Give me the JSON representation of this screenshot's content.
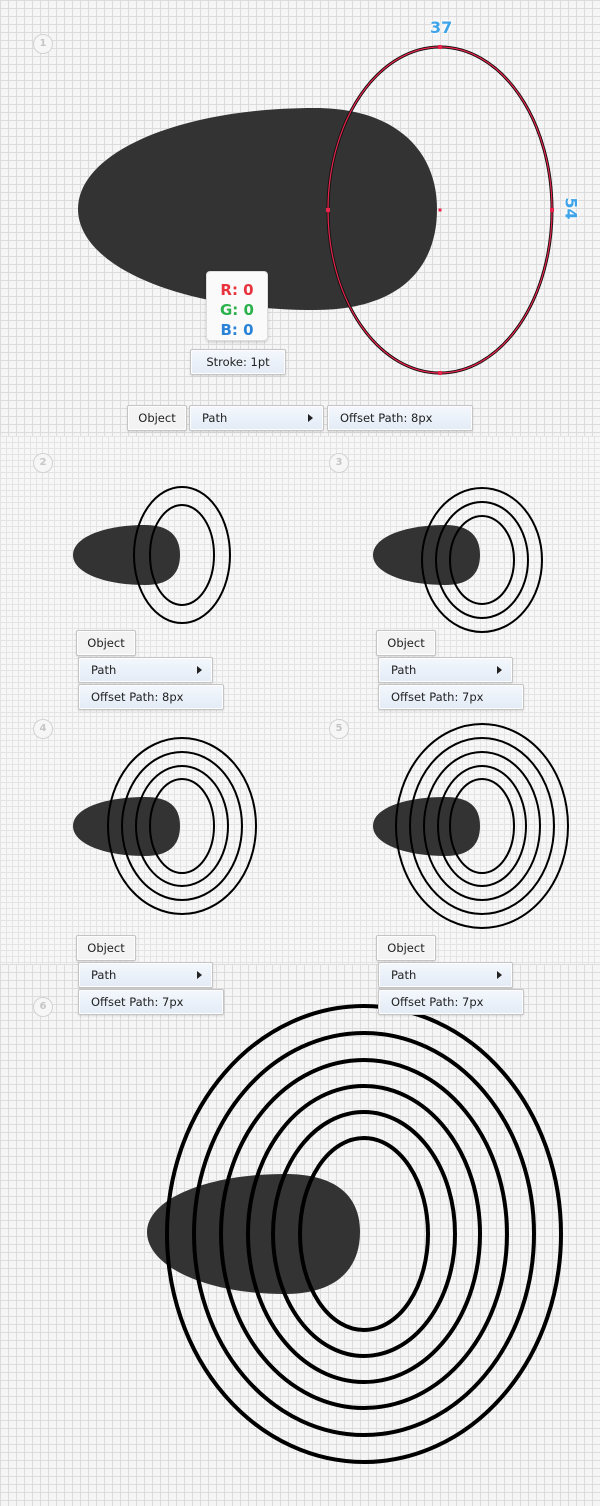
{
  "colors": {
    "shape_fill": "#333333",
    "selection": "#e8244c",
    "dimension": "#3ea3e8",
    "red": "#e8323c",
    "green": "#2bb24c",
    "blue": "#2b83d8"
  },
  "step1": {
    "number": "1",
    "width_label": "37",
    "height_label": "54",
    "rgb": {
      "r": "R: 0",
      "g": "G: 0",
      "b": "B: 0"
    },
    "stroke_label": "Stroke: 1pt",
    "menu": {
      "object": "Object",
      "path": "Path",
      "offset": "Offset Path: 8px"
    }
  },
  "step2": {
    "number": "2",
    "menu": {
      "object": "Object",
      "path": "Path",
      "offset": "Offset Path: 8px"
    }
  },
  "step3": {
    "number": "3",
    "menu": {
      "object": "Object",
      "path": "Path",
      "offset": "Offset Path: 7px"
    }
  },
  "step4": {
    "number": "4",
    "menu": {
      "object": "Object",
      "path": "Path",
      "offset": "Offset Path: 7px"
    }
  },
  "step5": {
    "number": "5",
    "menu": {
      "object": "Object",
      "path": "Path",
      "offset": "Offset Path: 7px"
    }
  },
  "step6": {
    "number": "6"
  },
  "icons": {
    "submenu": "submenu-arrow-icon"
  }
}
